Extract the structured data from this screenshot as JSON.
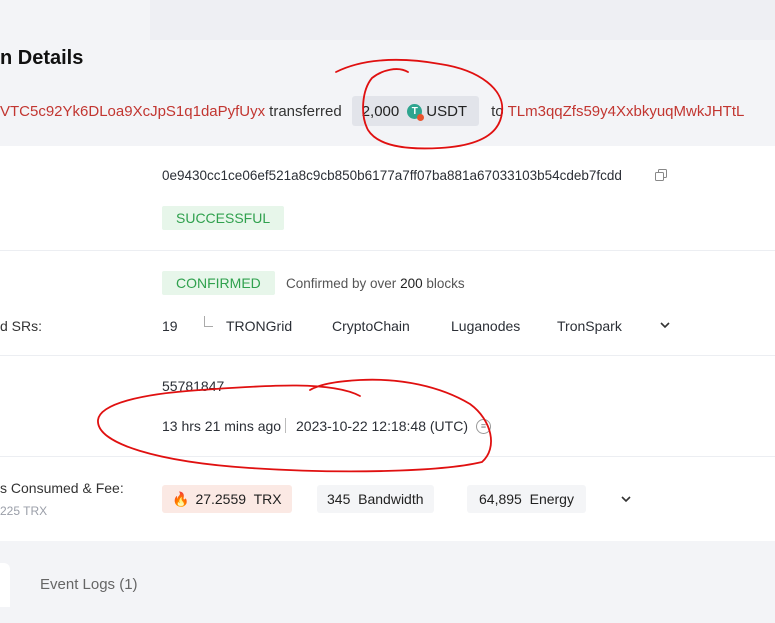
{
  "header": {
    "title": "n Details",
    "from_address": "VTC5c92Yk6DLoa9XcJpS1q1daPyfUyx",
    "transferred_label": "transferred",
    "amount": "2,000",
    "token_symbol": "USDT",
    "to_label": "to",
    "to_address": "TLm3qqZfs59y4XxbkyuqMwkJHTtL"
  },
  "hash_row": {
    "hash": "0e9430cc1ce06ef521a8c9cb850b6177a7ff07ba881a67033103b54cdeb7fcdd",
    "status": "SUCCESSFUL"
  },
  "confirm_row": {
    "badge": "CONFIRMED",
    "confirmed_prefix": "Confirmed by over",
    "confirmed_count": "200",
    "confirmed_suffix": "blocks",
    "srs_label": "d SRs:",
    "sr_count": "19",
    "srs": [
      "TRONGrid",
      "CryptoChain",
      "Luganodes",
      "TronSpark"
    ]
  },
  "block_row": {
    "block": "55781847",
    "age": "13 hrs 21 mins ago",
    "timestamp": "2023-10-22 12:18:48 (UTC)"
  },
  "fee_row": {
    "label": "s Consumed & Fee:",
    "sub": "225 TRX",
    "trx_value": "27.2559",
    "trx_unit": "TRX",
    "bandwidth_value": "345",
    "bandwidth_unit": "Bandwidth",
    "energy_value": "64,895",
    "energy_unit": "Energy"
  },
  "tabs": {
    "event_logs": "Event Logs (1)"
  },
  "colors": {
    "address": "#c23631",
    "success": "#30a14e",
    "annotation": "#e01010"
  }
}
